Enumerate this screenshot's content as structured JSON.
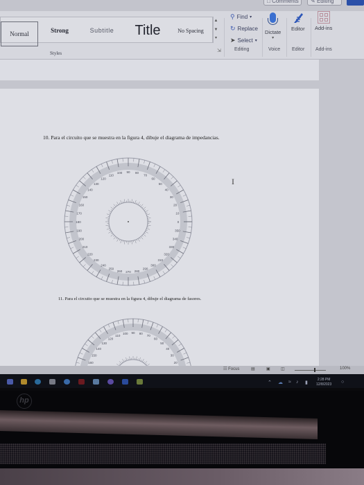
{
  "topbar": {
    "comments_label": "Comments",
    "editing_label": "Editing"
  },
  "ribbon": {
    "styles": {
      "items": [
        "Normal",
        "Strong",
        "Subtitle",
        "Title",
        "No Spacing"
      ],
      "group_label": "Styles"
    },
    "editing": {
      "find_label": "Find",
      "replace_label": "Replace",
      "select_label": "Select",
      "group_label": "Editing",
      "find_icon": "search-icon",
      "replace_icon": "replace-icon",
      "select_icon": "cursor-icon"
    },
    "voice": {
      "dictate_label": "Dictate",
      "group_label": "Voice",
      "icon": "microphone-icon"
    },
    "editor": {
      "editor_label": "Editor",
      "group_label": "Editor",
      "icon": "editor-pen-icon"
    },
    "addins": {
      "addins_label": "Add-ins",
      "group_label": "Add-ins",
      "icon": "add-ins-grid-icon"
    }
  },
  "document": {
    "question_10": "10. Para el circuito que se muestra en la figura 4, dibuje el diagrama de impedancias.",
    "question_11": "11. Para el circuito que se muestra en la figura 4, dibuje el diagrama de fasores."
  },
  "statusbar": {
    "focus_label": "Focus",
    "zoom_level": "100%",
    "zoom_fraction": 0.5
  },
  "taskbar": {
    "apps": [
      "widgets",
      "file-explorer",
      "edge",
      "camera",
      "chrome",
      "app-red",
      "mail",
      "teams",
      "word",
      "app-green"
    ],
    "time": "2:28 PM",
    "date": "12/8/2023"
  },
  "colors": {
    "accent": "#2a4fa8",
    "ribbon_bg": "#d6d7de",
    "page_bg": "#dedfe5"
  }
}
